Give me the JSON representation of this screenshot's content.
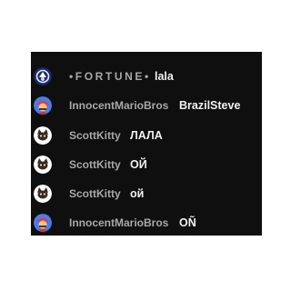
{
  "chat": {
    "messages": [
      {
        "author": "•FORTUNE•",
        "text": "lala",
        "avatar": "fortune-avatar"
      },
      {
        "author": "InnocentMarioBros",
        "text": "BrazilSteve",
        "avatar": "mario-avatar"
      },
      {
        "author": "ScottKitty",
        "text": "ЛАЛА",
        "avatar": "kitty-avatar"
      },
      {
        "author": "ScottKitty",
        "text": "ОЙ",
        "avatar": "kitty-avatar"
      },
      {
        "author": "ScottKitty",
        "text": "ой",
        "avatar": "kitty-avatar"
      },
      {
        "author": "InnocentMarioBros",
        "text": "ОÑ",
        "avatar": "mario-avatar"
      }
    ]
  },
  "colors": {
    "background": "#0f0f0f",
    "author": "#a8a8a8",
    "message": "#f1f1f1"
  }
}
